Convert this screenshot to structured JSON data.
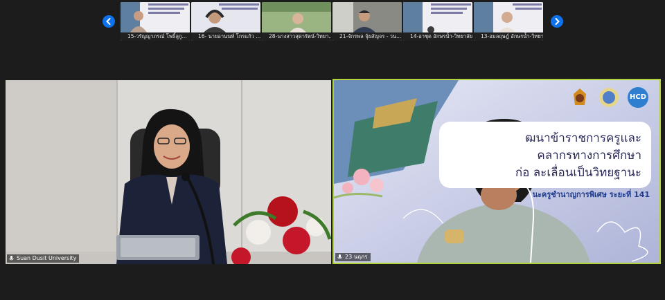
{
  "gallery": {
    "participants": [
      {
        "label": "15-วรัญญาภรณ์ โพธิ์ลูกู...",
        "bg": "#e9e9ef"
      },
      {
        "label": "16- นายอานนท์ โกรแก้ว ...",
        "bg": "#dcdde6"
      },
      {
        "label": "28-นางสาวสุดารัตน์-วิทยา...",
        "bg": "#7f9b6a"
      },
      {
        "label": "21-จักรพล จุ้ยสัญจร - วน...",
        "bg": "#6f6f6a"
      },
      {
        "label": "14-อาชุด อักษรน้ำ-วิทยาลัย...",
        "bg": "#e9e9ef"
      },
      {
        "label": "13-อมลฤษฎ์ อักษรน้ำ-วิทยา...",
        "bg": "#e9e9ef"
      }
    ]
  },
  "tiles": {
    "left": {
      "name": "Suan Dusit University"
    },
    "right": {
      "name": "23 นฤภร",
      "slide_line1": "ฒนาข้าราชการครูและ",
      "slide_line2": "คลากรทางการศึกษา",
      "slide_line3": "ก่อ            ละเลื่อนเป็นวิทยฐานะ",
      "slide_sub": "นะครูชำนาญการพิเศษ ระยะที่ 141",
      "logo_text": "HCD"
    }
  },
  "colors": {
    "accent": "#0e72ed",
    "active_border": "#b3d33a"
  }
}
